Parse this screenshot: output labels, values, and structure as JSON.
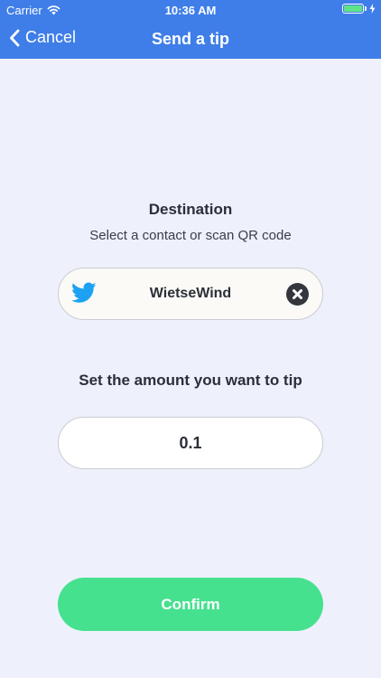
{
  "status_bar": {
    "carrier": "Carrier",
    "time": "10:36 AM",
    "icons": [
      "wifi-icon",
      "battery-icon",
      "charging-icon"
    ]
  },
  "nav": {
    "back_label": "Cancel",
    "title": "Send a tip",
    "back_icon": "chevron-left-icon"
  },
  "destination": {
    "title": "Destination",
    "subtitle": "Select a contact or scan QR code",
    "platform_icon": "twitter-icon",
    "selected": "WietseWind",
    "clear_icon": "close-circle-icon"
  },
  "amount": {
    "label": "Set the amount you want to tip",
    "value": "0.1"
  },
  "confirm": {
    "label": "Confirm"
  },
  "colors": {
    "header": "#3f7ee8",
    "background": "#eef1fb",
    "confirm": "#46e18f",
    "twitter": "#1da1f2",
    "text": "#2b2f38"
  }
}
